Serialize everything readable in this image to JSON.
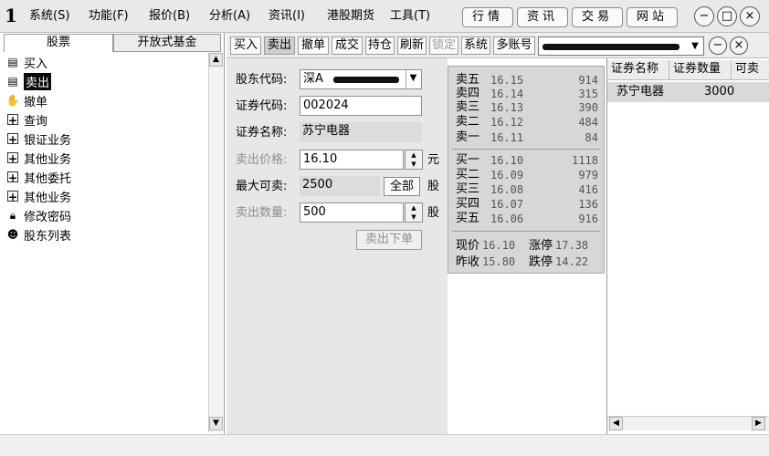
{
  "app": {
    "logo": "1",
    "menu": [
      "系统(S)",
      "功能(F)",
      "报价(B)",
      "分析(A)",
      "资讯(I)",
      "港股期货",
      "工具(T)"
    ],
    "top_tabs": [
      "行情",
      "资讯",
      "交易",
      "网站"
    ],
    "window_buttons": [
      "−",
      "□",
      "×"
    ]
  },
  "sidebar": {
    "tabs": [
      "股票",
      "开放式基金"
    ],
    "items": [
      {
        "label": "买入",
        "icon": "buy-icon"
      },
      {
        "label": "卖出",
        "icon": "sell-icon",
        "selected": true
      },
      {
        "label": "撤单",
        "icon": "cancel-hand-icon"
      },
      {
        "label": "查询",
        "icon": "expand-icon"
      },
      {
        "label": "银证业务",
        "icon": "expand-icon"
      },
      {
        "label": "其他业务",
        "icon": "expand-icon"
      },
      {
        "label": "其他委托",
        "icon": "expand-icon"
      },
      {
        "label": "其他业务",
        "icon": "expand-icon"
      },
      {
        "label": "修改密码",
        "icon": "lock-icon"
      },
      {
        "label": "股东列表",
        "icon": "user-icon"
      }
    ]
  },
  "toolbar": {
    "buttons": [
      "买入",
      "卖出",
      "撤单",
      "成交",
      "持仓",
      "刷新",
      "锁定",
      "系统",
      "多账号"
    ],
    "active": "卖出",
    "disabled": "锁定",
    "panel_buttons": [
      "−",
      "×"
    ]
  },
  "form": {
    "shareholder_label": "股东代码:",
    "shareholder_value": "深A",
    "code_label": "证券代码:",
    "code_value": "002024",
    "name_label": "证券名称:",
    "name_value": "苏宁电器",
    "price_label": "卖出价格:",
    "price_value": "16.10",
    "price_unit": "元",
    "max_label": "最大可卖:",
    "max_value": "2500",
    "all_button": "全部",
    "max_unit": "股",
    "qty_label": "卖出数量:",
    "qty_value": "500",
    "qty_unit": "股",
    "submit_button": "卖出下单"
  },
  "quote": {
    "sell": [
      {
        "label": "卖五",
        "price": "16.15",
        "volume": "914"
      },
      {
        "label": "卖四",
        "price": "16.14",
        "volume": "315"
      },
      {
        "label": "卖三",
        "price": "16.13",
        "volume": "390"
      },
      {
        "label": "卖二",
        "price": "16.12",
        "volume": "484"
      },
      {
        "label": "卖一",
        "price": "16.11",
        "volume": "84"
      }
    ],
    "buy": [
      {
        "label": "买一",
        "price": "16.10",
        "volume": "1118"
      },
      {
        "label": "买二",
        "price": "16.09",
        "volume": "979"
      },
      {
        "label": "买三",
        "price": "16.08",
        "volume": "416"
      },
      {
        "label": "买四",
        "price": "16.07",
        "volume": "136"
      },
      {
        "label": "买五",
        "price": "16.06",
        "volume": "916"
      }
    ],
    "current_label": "现价",
    "current": "16.10",
    "limit_up_label": "涨停",
    "limit_up": "17.38",
    "prev_close_label": "昨收",
    "prev_close": "15.80",
    "limit_down_label": "跌停",
    "limit_down": "14.22"
  },
  "holdings": {
    "columns": [
      "证券名称",
      "证券数量",
      "可卖"
    ],
    "rows": [
      {
        "name": "苏宁电器",
        "quantity": "3000"
      }
    ]
  },
  "scroll": {
    "up": "▲",
    "down": "▼",
    "left": "◀",
    "right": "▶"
  }
}
